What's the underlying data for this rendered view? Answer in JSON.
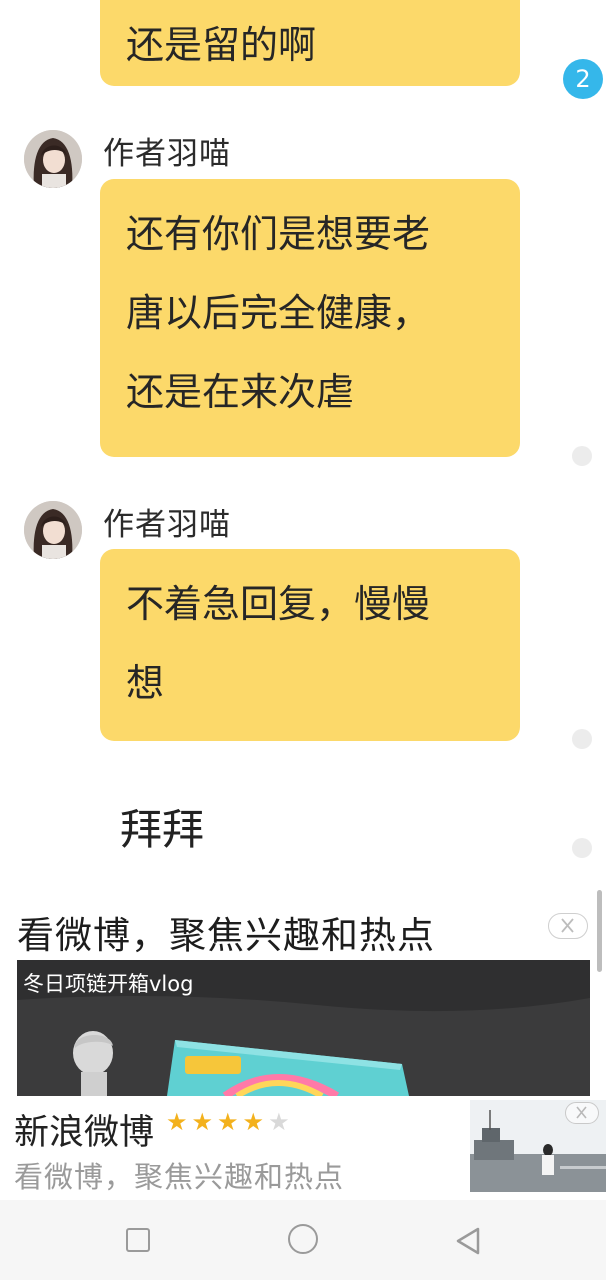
{
  "chat": {
    "unread_badge": "2",
    "top_bubble_fragment": "还是留的啊",
    "messages": [
      {
        "author": "作者羽喵",
        "lines": [
          "还有你们是想要老",
          "唐以后完全健康，",
          "还是在来次虐"
        ]
      },
      {
        "author": "作者羽喵",
        "lines": [
          "不着急回复，慢慢",
          "想"
        ]
      }
    ],
    "plain_message": "拜拜"
  },
  "ad": {
    "headline": "看微博，聚焦兴趣和热点",
    "video_caption": "冬日项链开箱vlog",
    "app_name": "新浪微博",
    "rating_stars": 4,
    "rating_max": 5,
    "app_description": "看微博，聚焦兴趣和热点"
  },
  "colors": {
    "bubble": "#fcd96a",
    "badge": "#35b7ea",
    "star": "#f3b11c"
  },
  "icons": [
    "close-icon",
    "star-icon",
    "recent-apps-icon",
    "home-icon",
    "back-icon"
  ]
}
